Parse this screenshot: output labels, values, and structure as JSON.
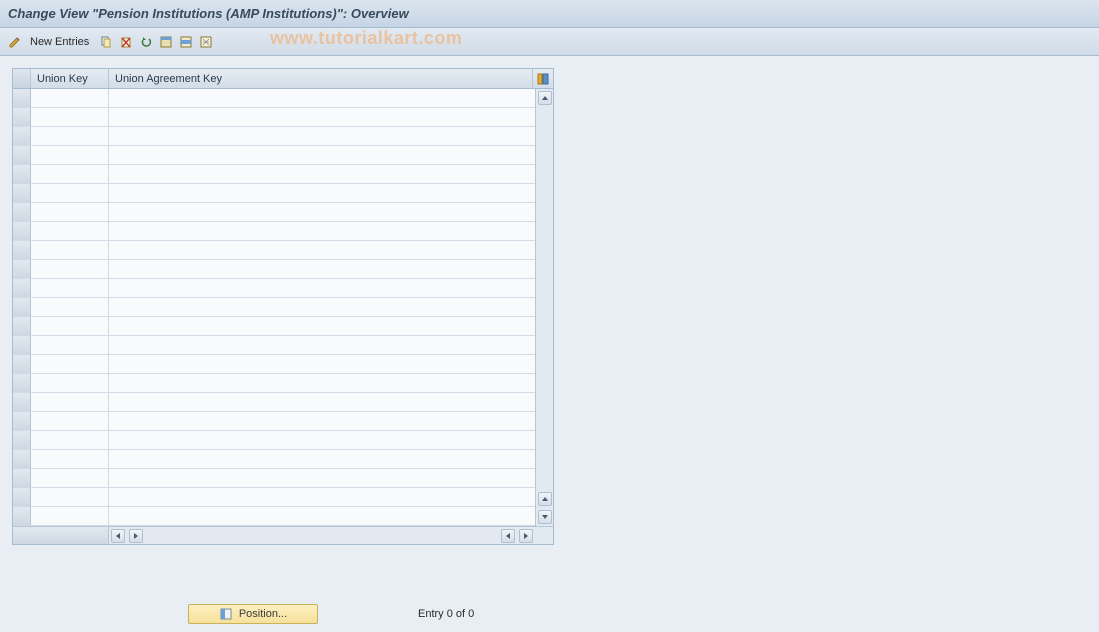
{
  "header": {
    "title": "Change View \"Pension Institutions (AMP Institutions)\": Overview"
  },
  "toolbar": {
    "change_icon": "change-mode-icon",
    "new_entries_label": "New Entries",
    "copy_icon": "copy-icon",
    "delete_icon": "delete-icon",
    "undo_icon": "undo-icon",
    "select_all_icon": "select-all-icon",
    "select_block_icon": "select-block-icon",
    "deselect_all_icon": "deselect-all-icon"
  },
  "watermark": "www.tutorialkart.com",
  "table": {
    "columns": {
      "col1": "Union Key",
      "col2": "Union Agreement Key"
    },
    "config_icon": "table-config-icon",
    "row_count": 23
  },
  "footer": {
    "position_label": "Position...",
    "entry_status": "Entry 0 of 0"
  }
}
